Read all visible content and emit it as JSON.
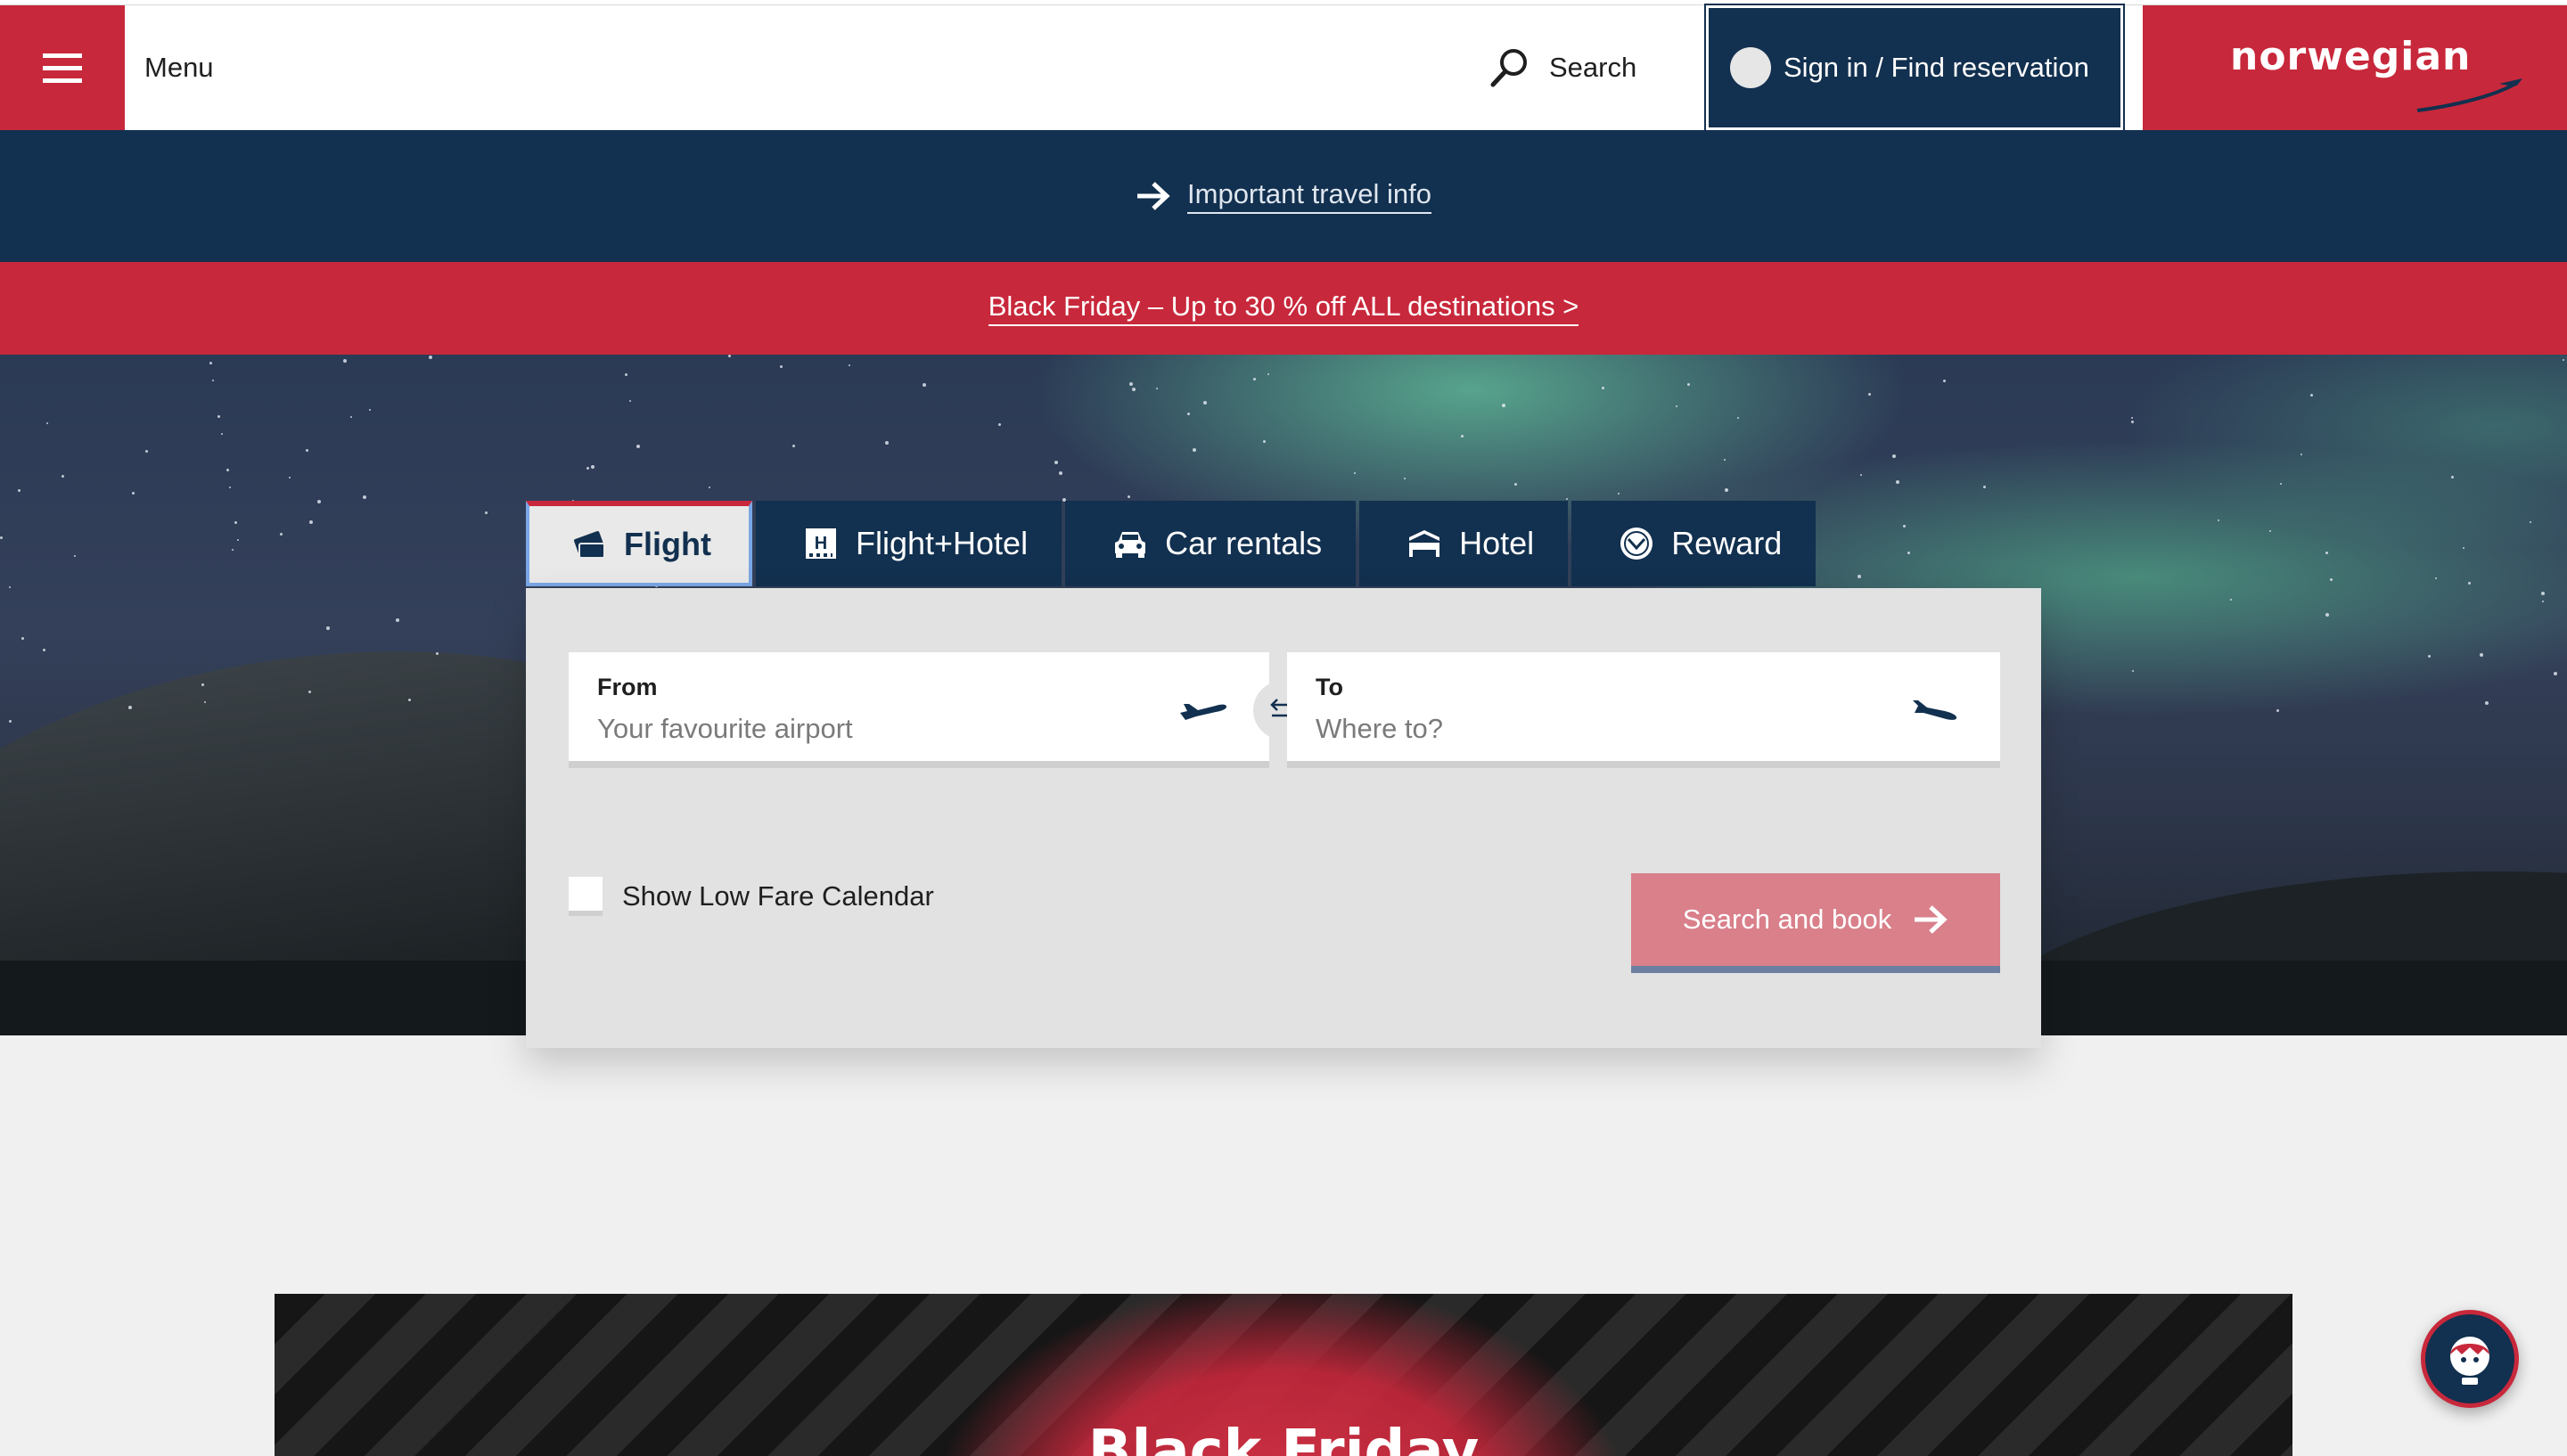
{
  "header": {
    "menu_label": "Menu",
    "search_label": "Search",
    "signin_label": "Sign in / Find reservation",
    "logo_text": "norwegian"
  },
  "info_bar": {
    "link_text": "Important travel info"
  },
  "promo_bar": {
    "link_text": "Black Friday – Up to 30 % off ALL destinations >"
  },
  "booking": {
    "tabs": [
      {
        "label": "Flight",
        "icon": "flight-ticket-icon",
        "active": true
      },
      {
        "label": "Flight+Hotel",
        "icon": "hotel-building-icon",
        "active": false
      },
      {
        "label": "Car rentals",
        "icon": "car-icon",
        "active": false
      },
      {
        "label": "Hotel",
        "icon": "bed-icon",
        "active": false
      },
      {
        "label": "Reward",
        "icon": "reward-badge-icon",
        "active": false
      }
    ],
    "from": {
      "label": "From",
      "placeholder": "Your favourite airport"
    },
    "to": {
      "label": "To",
      "placeholder": "Where to?"
    },
    "low_fare_label": "Show Low Fare Calendar",
    "search_button": "Search and book"
  },
  "lower_promo": {
    "title": "Black Friday"
  },
  "colors": {
    "brand_red": "#c8283b",
    "navy": "#12304f",
    "button_pink": "#d9808b"
  }
}
